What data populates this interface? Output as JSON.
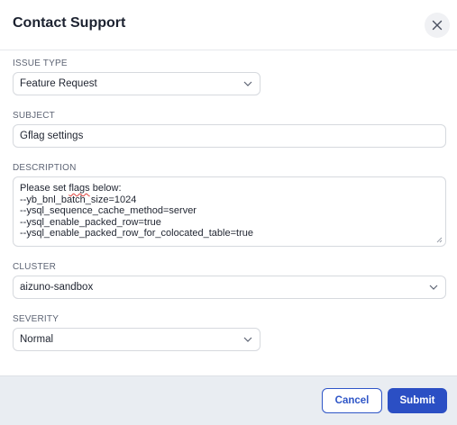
{
  "dialog": {
    "title": "Contact Support",
    "close_icon": "close-icon"
  },
  "issue_type": {
    "label": "ISSUE TYPE",
    "value": "Feature Request"
  },
  "subject": {
    "label": "SUBJECT",
    "value": "Gflag settings"
  },
  "description": {
    "label": "DESCRIPTION",
    "lines": {
      "l1_before": "Please set ",
      "l1_word": "flags",
      "l1_after": " below:",
      "l2": "--yb_bnl_batch_size=1024",
      "l3": "--ysql_sequence_cache_method=server",
      "l4": "--ysql_enable_packed_row=true",
      "l5": "--ysql_enable_packed_row_for_colocated_table=true"
    }
  },
  "cluster": {
    "label": "CLUSTER",
    "value": "aizuno-sandbox"
  },
  "severity": {
    "label": "SEVERITY",
    "value": "Normal"
  },
  "footer": {
    "cancel_label": "Cancel",
    "submit_label": "Submit"
  },
  "colors": {
    "accent": "#2b4fc4",
    "footer_bg": "#e9edf2",
    "border": "#d6d9de"
  }
}
